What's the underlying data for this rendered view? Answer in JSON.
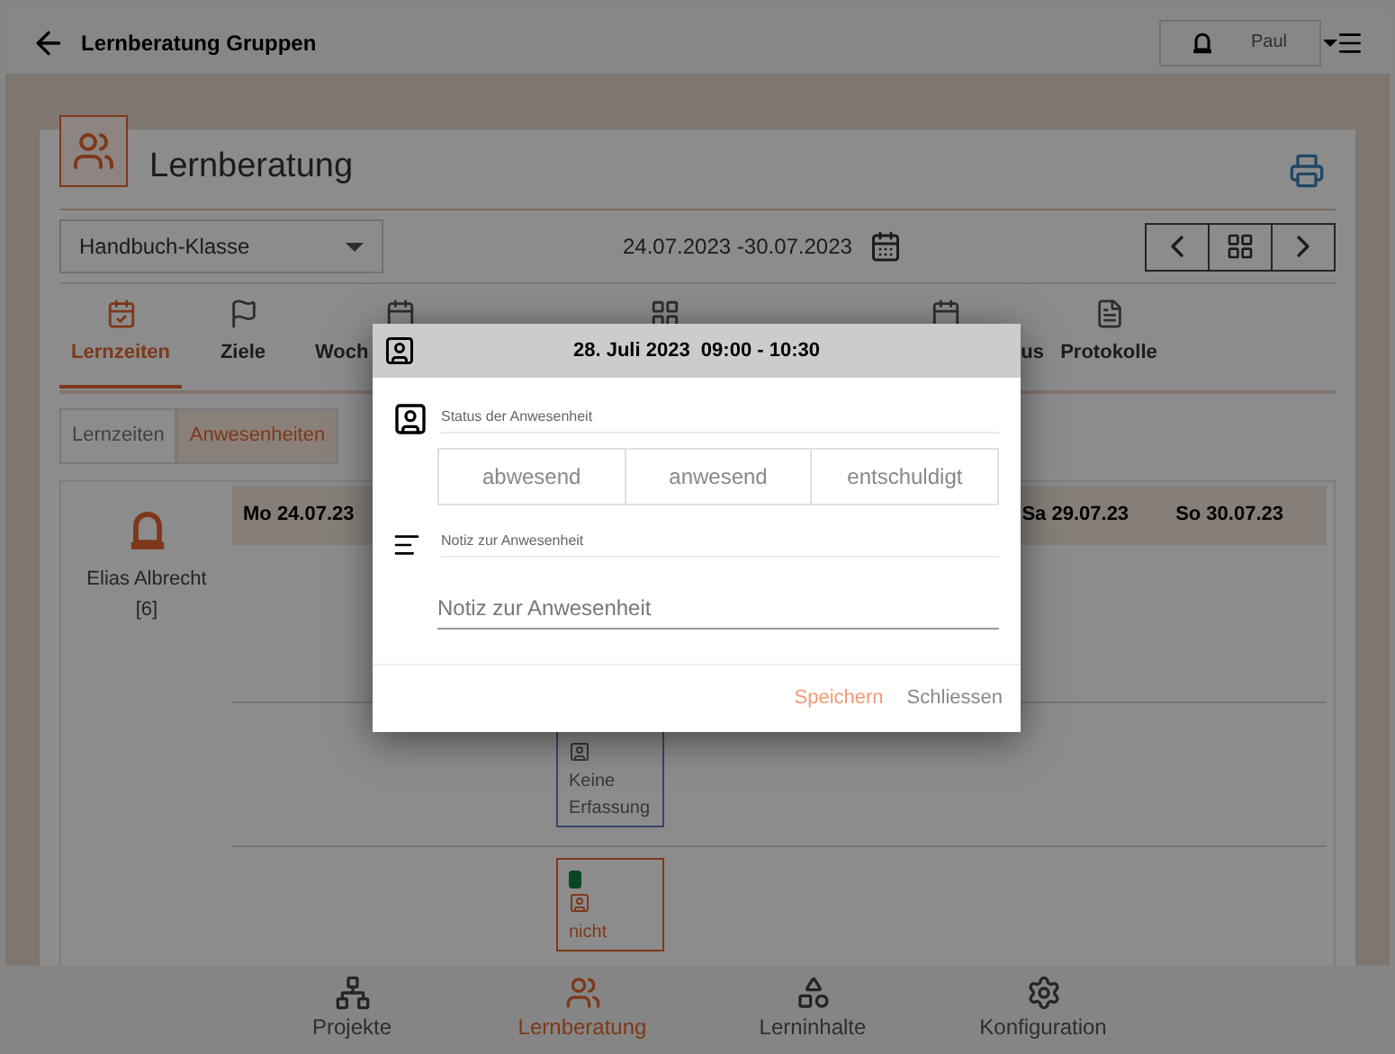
{
  "header": {
    "title": "Lernberatung Gruppen",
    "user": "Paul"
  },
  "page": {
    "title": "Lernberatung",
    "class_select": "Handbuch-Klasse",
    "date_range": "24.07.2023 -30.07.2023"
  },
  "tabs": [
    {
      "label": "Lernzeiten",
      "selected": true
    },
    {
      "label": "Ziele",
      "selected": false
    },
    {
      "label": "Woch",
      "selected": false
    },
    {
      "selected": false
    },
    {
      "label": "us",
      "selected": false
    },
    {
      "label": "Protokolle",
      "selected": false
    }
  ],
  "subtabs": [
    {
      "label": "Lernzeiten",
      "selected": false
    },
    {
      "label": "Anwesenheiten",
      "selected": true
    }
  ],
  "student": {
    "name": "Elias Albrecht",
    "count": "[6]"
  },
  "days": [
    "Mo 24.07.23",
    "Sa 29.07.23",
    "So 30.07.23"
  ],
  "entries": [
    {
      "label": "Keine Erfassung",
      "kind": "none"
    },
    {
      "label": "nicht",
      "kind": "recorded"
    }
  ],
  "modal": {
    "title": "28. Juli 2023  09:00 - 10:30",
    "status_label": "Status der Anwesenheit",
    "status_options": [
      {
        "label": "abwesend",
        "selected": false
      },
      {
        "label": "anwesend",
        "selected": false
      },
      {
        "label": "entschuldigt",
        "selected": false
      }
    ],
    "note_label": "Notiz zur Anwesenheit",
    "note_placeholder": "Notiz zur Anwesenheit",
    "buttons": [
      {
        "label": "Speichern",
        "kind": "primary"
      },
      {
        "label": "Schliessen",
        "kind": "secondary"
      }
    ]
  },
  "bottom_nav": [
    {
      "label": "Projekte",
      "selected": false
    },
    {
      "label": "Lernberatung",
      "selected": true
    },
    {
      "label": "Lerninhalte",
      "selected": false
    },
    {
      "label": "Konfiguration",
      "selected": false
    }
  ]
}
